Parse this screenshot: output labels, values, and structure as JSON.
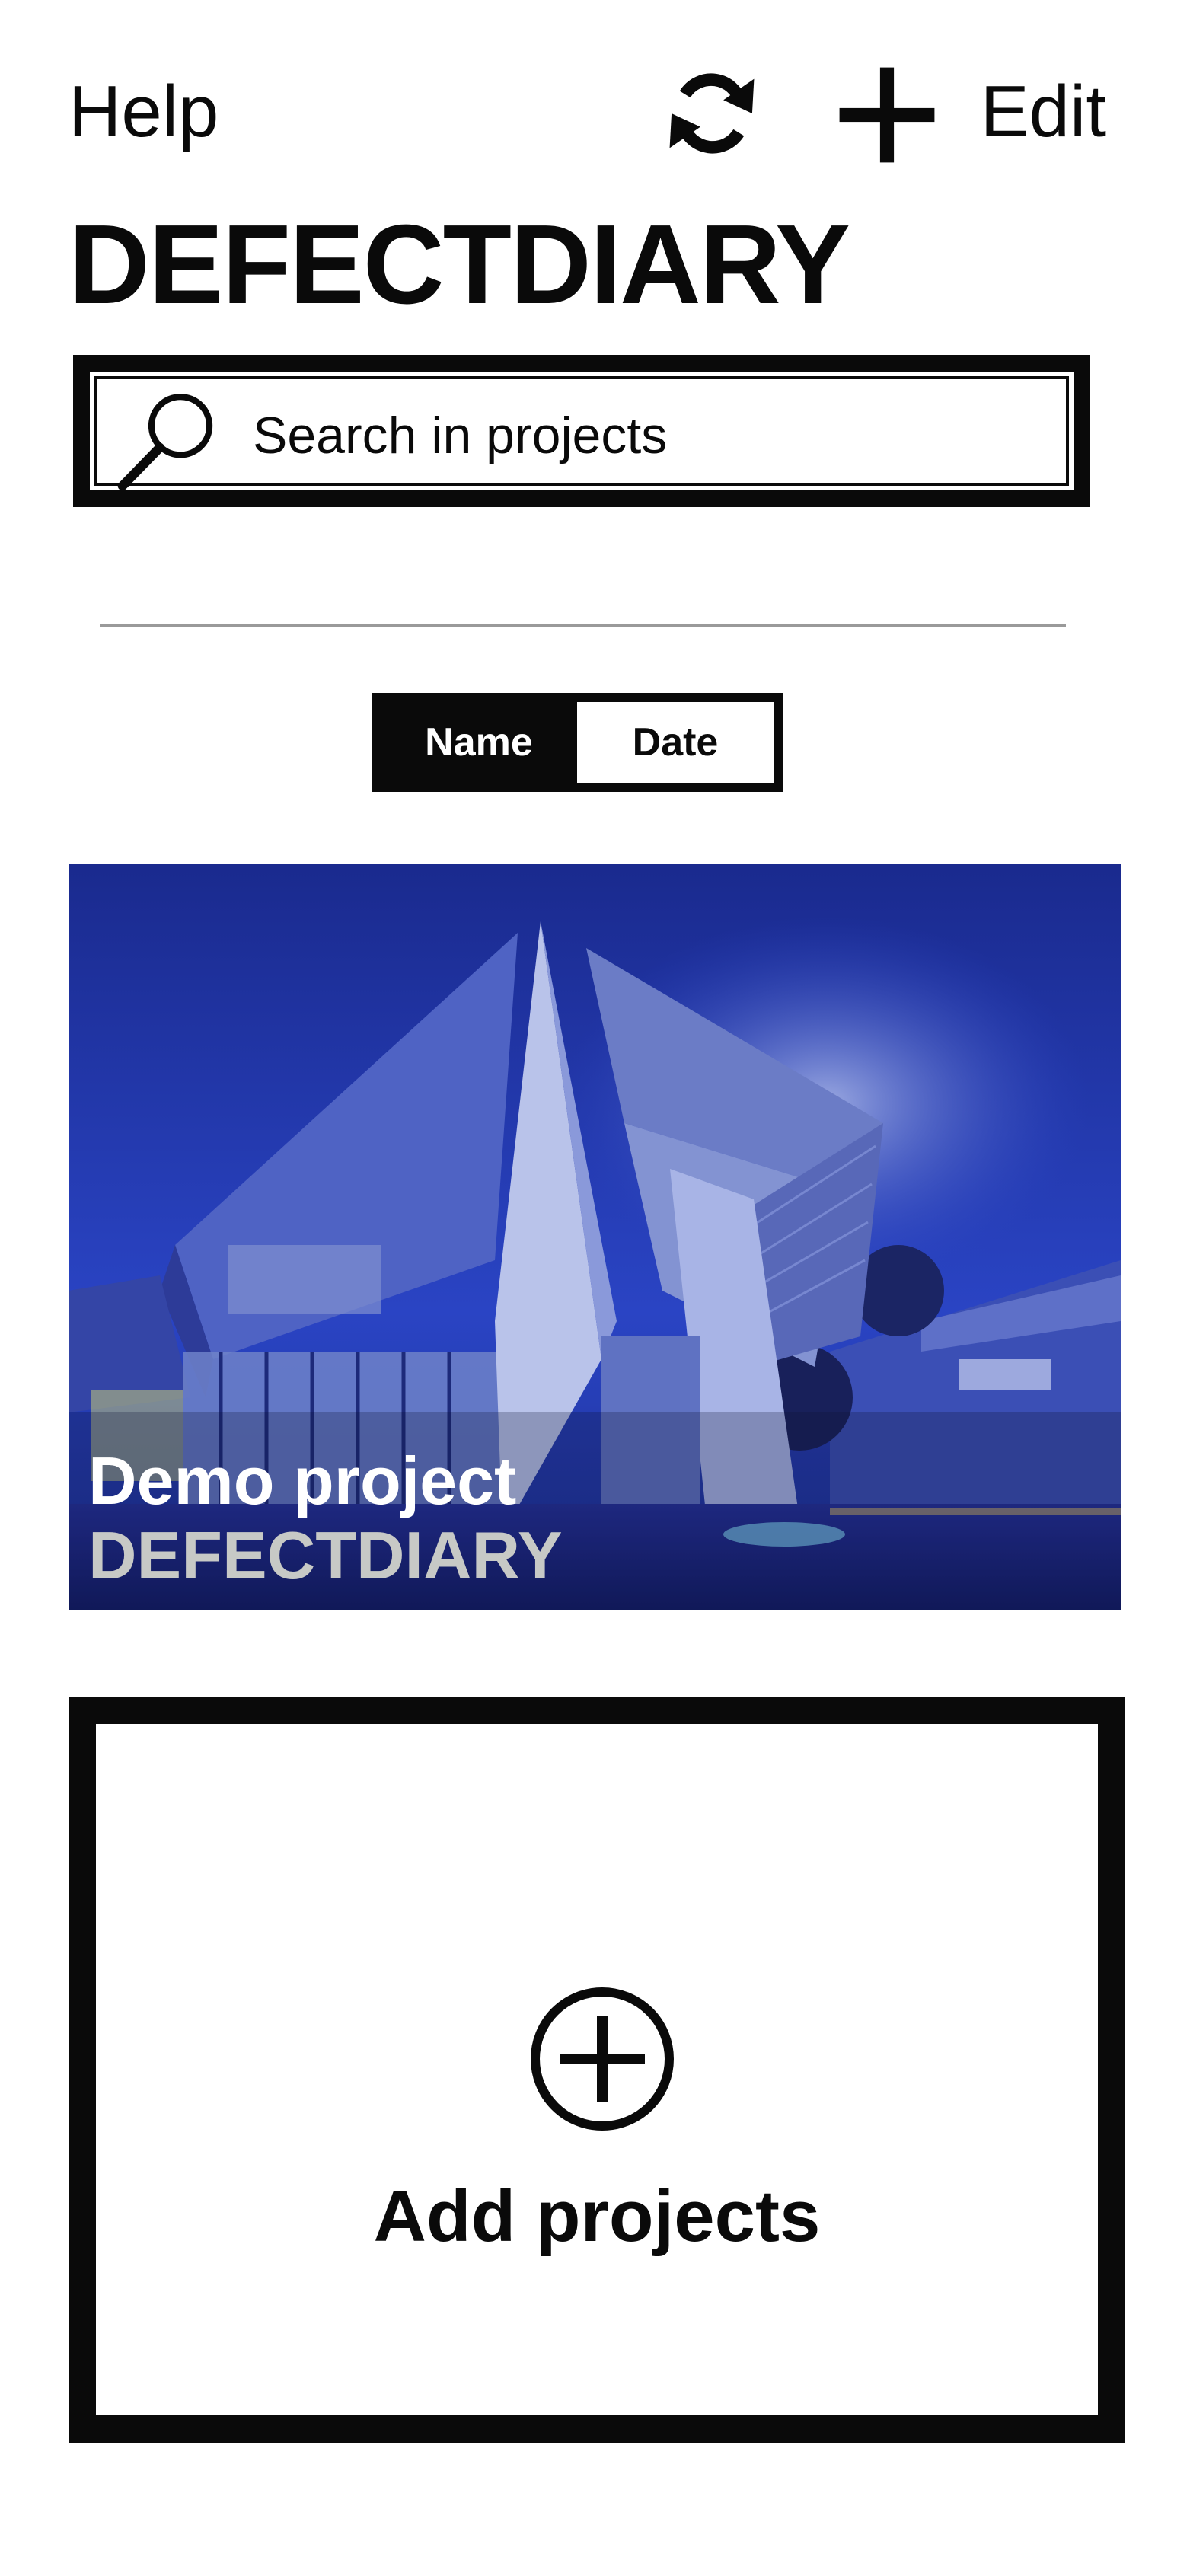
{
  "topbar": {
    "help_label": "Help",
    "edit_label": "Edit",
    "refresh_icon": "refresh-icon",
    "add_icon": "plus-icon"
  },
  "app": {
    "title": "DEFECTDIARY"
  },
  "search": {
    "placeholder": "Search in projects",
    "icon": "search-icon"
  },
  "sort": {
    "options": [
      {
        "label": "Name",
        "selected": true
      },
      {
        "label": "Date",
        "selected": false
      }
    ]
  },
  "projects": [
    {
      "name": "Demo project",
      "subtitle": "DEFECTDIARY"
    }
  ],
  "add_project": {
    "label": "Add projects",
    "icon": "circle-plus-icon"
  },
  "colors": {
    "ink": "#0a0a0a",
    "background": "#ffffff",
    "divider": "#9a9a9a",
    "sky": "#2236a8",
    "subtitle_text": "#c7c9c6"
  }
}
